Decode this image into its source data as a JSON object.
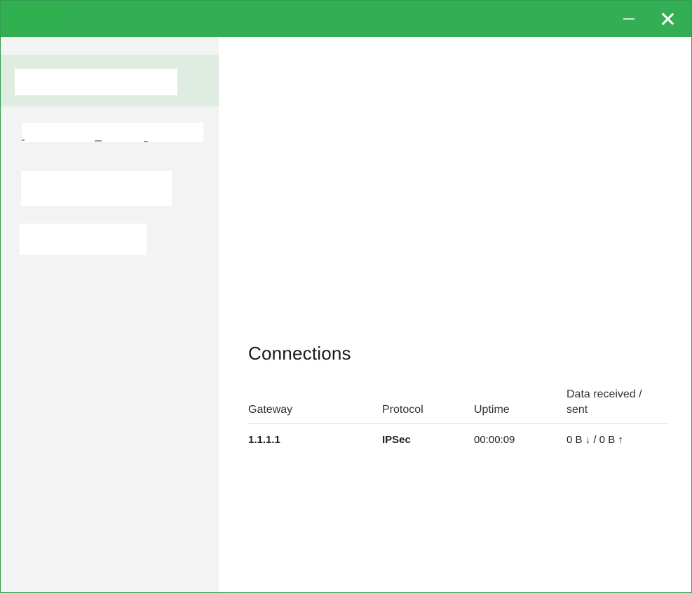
{
  "window": {
    "accent_color": "#34ae55",
    "minimize_icon": "minimize-icon",
    "close_icon": "close-icon"
  },
  "sidebar": {
    "items": [
      {
        "label": "",
        "selected": true
      },
      {
        "label": ""
      },
      {
        "label": ""
      },
      {
        "label": ""
      }
    ]
  },
  "connections": {
    "title": "Connections",
    "columns": [
      "Gateway",
      "Protocol",
      "Uptime",
      "Data received / sent"
    ],
    "rows": [
      {
        "gateway": "1.1.1.1",
        "protocol": "IPSec",
        "uptime": "00:00:09",
        "data": "0 B ↓ / 0 B ↑"
      }
    ]
  }
}
